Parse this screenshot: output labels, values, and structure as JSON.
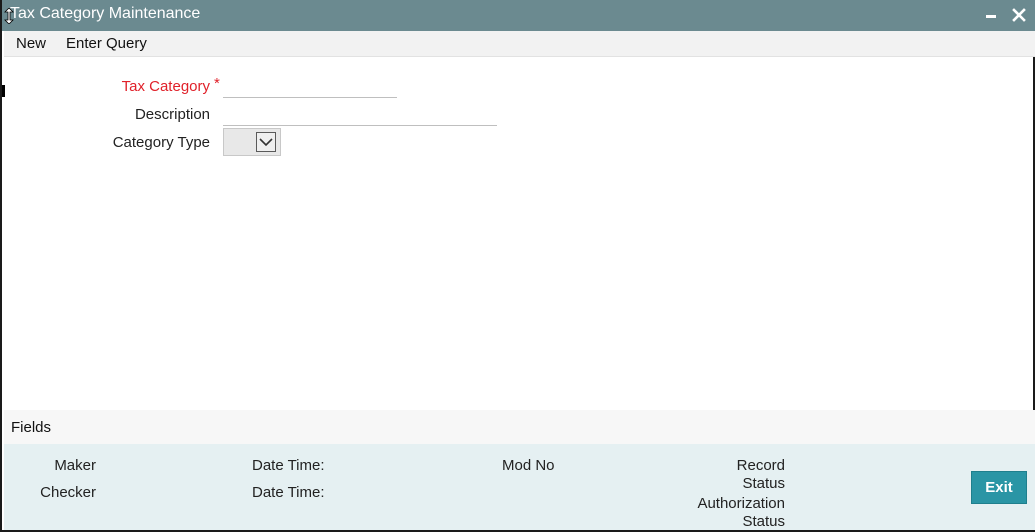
{
  "window": {
    "title": "Tax Category Maintenance",
    "colors": {
      "titlebar": "#6b8a90",
      "required": "#e0212a",
      "exit_button": "#2a95a5",
      "audit_bg": "#e5f0f2"
    },
    "icons": {
      "minimize": "minimize-icon",
      "close": "close-icon",
      "resize": "resize-cursor-icon"
    }
  },
  "toolbar": {
    "new_label": "New",
    "enter_query_label": "Enter Query"
  },
  "form": {
    "tax_category": {
      "label": "Tax Category",
      "required_mark": "*",
      "value": ""
    },
    "description": {
      "label": "Description",
      "value": ""
    },
    "category_type": {
      "label": "Category Type",
      "selected": ""
    }
  },
  "fields_section": {
    "label": "Fields"
  },
  "audit": {
    "maker_label": "Maker",
    "checker_label": "Checker",
    "date_time_label_1": "Date Time:",
    "date_time_label_2": "Date Time:",
    "mod_no_label": "Mod No",
    "record_label": "Record",
    "status_label_1": "Status",
    "authorization_label": "Authorization",
    "status_label_2": "Status",
    "exit_label": "Exit"
  }
}
